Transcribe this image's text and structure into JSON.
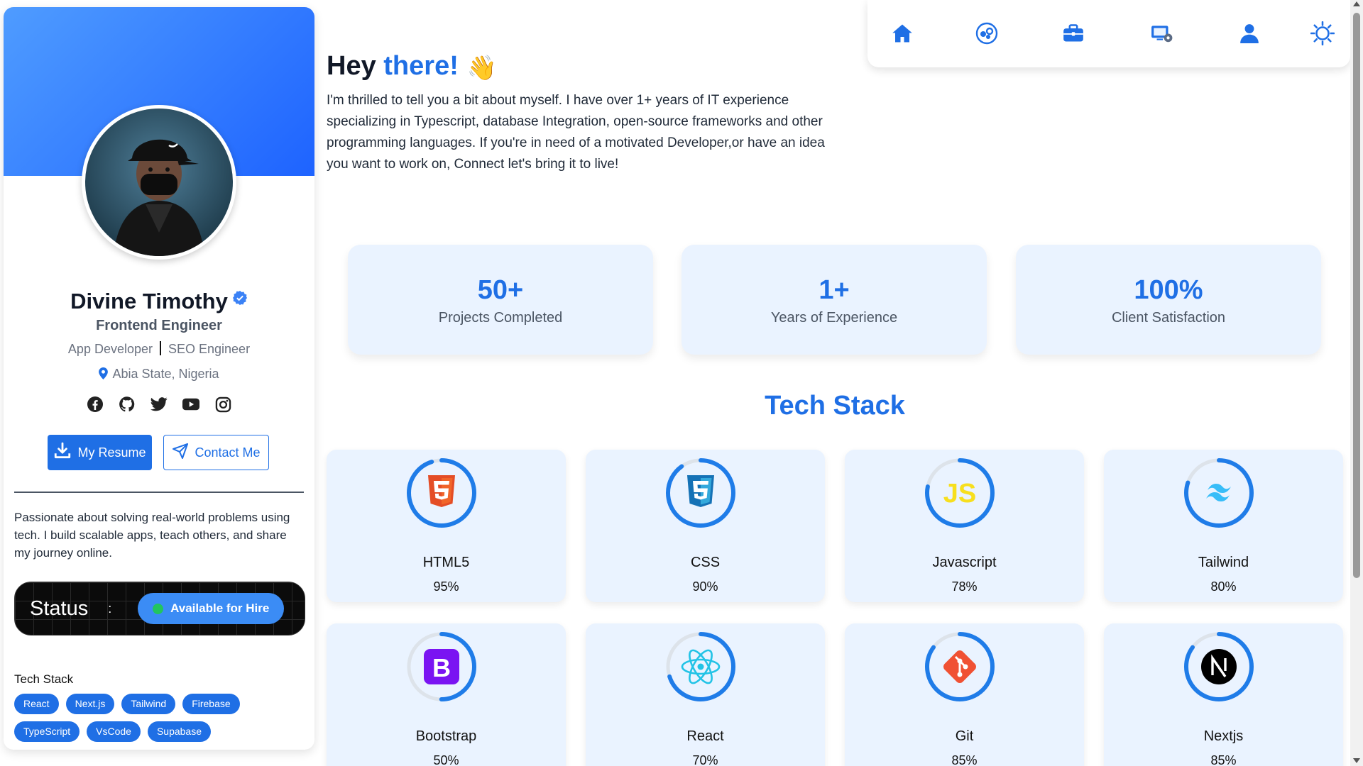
{
  "profile": {
    "name": "Divine Timothy",
    "role": "Frontend Engineer",
    "subroles": [
      "App Developer",
      "SEO Engineer"
    ],
    "location": "Abia State, Nigeria",
    "socials": [
      "facebook-icon",
      "github-icon",
      "twitter-icon",
      "youtube-icon",
      "instagram-icon"
    ],
    "resume_label": "My Resume",
    "contact_label": "Contact Me",
    "bio": "Passionate about solving real-world problems using tech. I build scalable apps, teach others, and share my journey online.",
    "status_label": "Status",
    "status_colon": ":",
    "status_value": "Available for Hire",
    "stack_title": "Tech Stack",
    "stack_chips": [
      "React",
      "Next.js",
      "Tailwind",
      "Firebase",
      "TypeScript",
      "VsCode",
      "Supabase"
    ]
  },
  "nav": {
    "items": [
      "home-icon",
      "services-icon",
      "portfolio-icon",
      "projects-icon",
      "about-icon",
      "theme-toggle-icon"
    ]
  },
  "hero": {
    "greeting": "Hey",
    "greeting_accent": "there!",
    "wave": "👋",
    "text": "I'm thrilled to tell you a bit about myself. I have over 1+ years of IT experience specializing in Typescript, database Integration, open-source frameworks and other programming languages. If you're in need of a motivated Developer,or have an idea you want to work on, Connect let's bring it to live!"
  },
  "stats": [
    {
      "value": "50+",
      "label": "Projects Completed"
    },
    {
      "value": "1+",
      "label": "Years of Experience"
    },
    {
      "value": "100%",
      "label": "Client Satisfaction"
    }
  ],
  "tech_stack": {
    "title": "Tech Stack",
    "skills": [
      {
        "name": "HTML5",
        "percent": "95%",
        "level": 95,
        "icon": "html5-icon"
      },
      {
        "name": "CSS",
        "percent": "90%",
        "level": 90,
        "icon": "css3-icon"
      },
      {
        "name": "Javascript",
        "percent": "78%",
        "level": 78,
        "icon": "javascript-icon"
      },
      {
        "name": "Tailwind",
        "percent": "80%",
        "level": 80,
        "icon": "tailwind-icon"
      },
      {
        "name": "Bootstrap",
        "percent": "50%",
        "level": 50,
        "icon": "bootstrap-icon"
      },
      {
        "name": "React",
        "percent": "70%",
        "level": 70,
        "icon": "react-icon"
      },
      {
        "name": "Git",
        "percent": "85%",
        "level": 85,
        "icon": "git-icon"
      },
      {
        "name": "Nextjs",
        "percent": "85%",
        "level": 85,
        "icon": "nextjs-icon"
      }
    ]
  },
  "colors": {
    "accent": "#1f6fe5",
    "card_bg": "#eaf3ff",
    "status_green": "#22c55e"
  }
}
